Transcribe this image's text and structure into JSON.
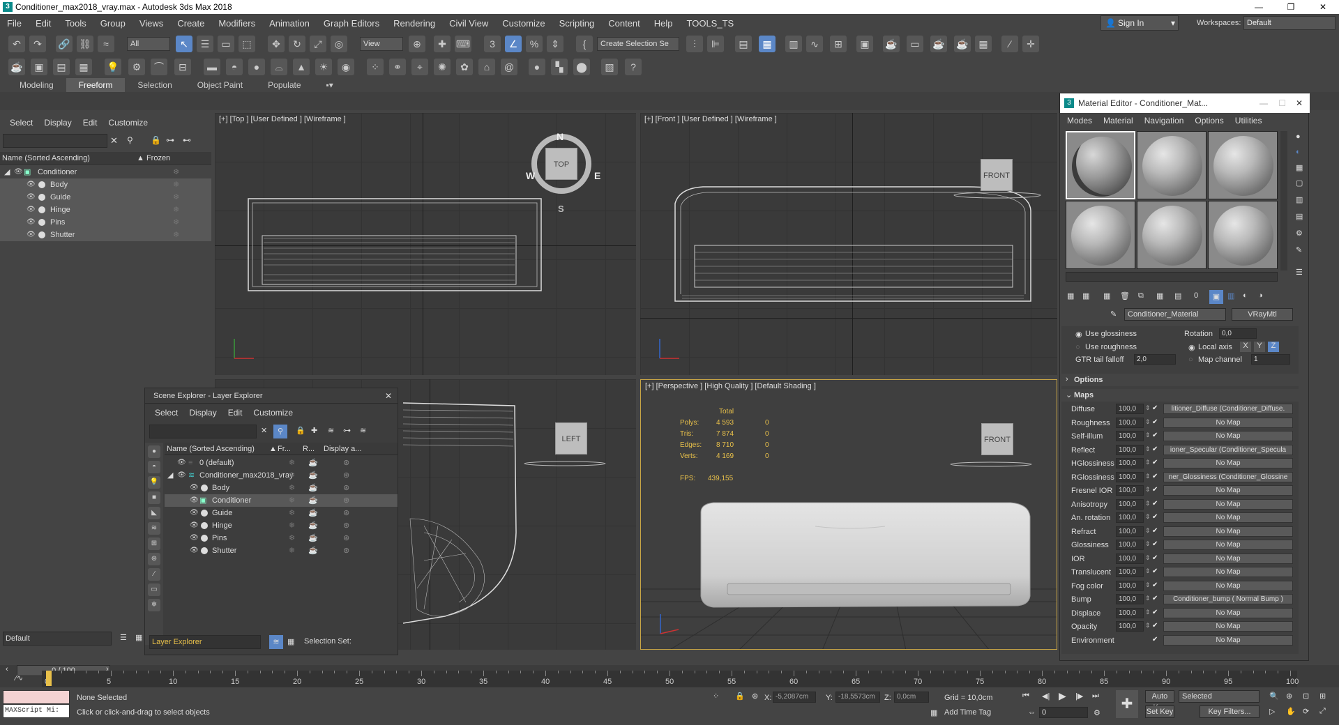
{
  "window": {
    "title": "Conditioner_max2018_vray.max - Autodesk 3ds Max 2018",
    "app_icon_letter": "3",
    "min": "—",
    "max": "❐",
    "close": "✕"
  },
  "menu": [
    "File",
    "Edit",
    "Tools",
    "Group",
    "Views",
    "Create",
    "Modifiers",
    "Animation",
    "Graph Editors",
    "Rendering",
    "Civil View",
    "Customize",
    "Scripting",
    "Content",
    "Help",
    "TOOLS_TS"
  ],
  "signin": "Sign In",
  "workspaces": {
    "label": "Workspaces:",
    "value": "Default"
  },
  "toolbar": {
    "filter_select": "All",
    "view_select": "View",
    "selection_set": "Create Selection Se"
  },
  "ribbon": [
    "Modeling",
    "Freeform",
    "Selection",
    "Object Paint",
    "Populate"
  ],
  "left_panel": {
    "menu": [
      "Select",
      "Display",
      "Edit",
      "Customize"
    ],
    "col_name": "Name (Sorted Ascending)",
    "col_frozen": "▲ Frozen",
    "root": "Conditioner",
    "children": [
      "Body",
      "Guide",
      "Hinge",
      "Pins",
      "Shutter"
    ],
    "layer_select": "Default"
  },
  "viewports": {
    "top": "[+] [Top ] [User Defined ] [Wireframe ]",
    "front": "[+] [Front ] [User Defined ] [Wireframe ]",
    "perspective": "[+] [Perspective ] [High Quality ] [Default Shading ]",
    "cube_top": "TOP",
    "cube_front": "FRONT",
    "cube_left": "LEFT",
    "compass": {
      "n": "N",
      "s": "S",
      "e": "E",
      "w": "W"
    }
  },
  "stats": {
    "header": "Total",
    "rows": [
      {
        "label": "Polys:",
        "total": "4 593",
        "sel": "0"
      },
      {
        "label": "Tris:",
        "total": "7 874",
        "sel": "0"
      },
      {
        "label": "Edges:",
        "total": "8 710",
        "sel": "0"
      },
      {
        "label": "Verts:",
        "total": "4 169",
        "sel": "0"
      }
    ],
    "fps_label": "FPS:",
    "fps": "439,155"
  },
  "layer_explorer": {
    "title": "Scene Explorer - Layer Explorer",
    "menu": [
      "Select",
      "Display",
      "Edit",
      "Customize"
    ],
    "cols": [
      "Name (Sorted Ascending)",
      "Fr...",
      "R...",
      "Display a..."
    ],
    "rows": [
      {
        "name": "0 (default)",
        "level": 1
      },
      {
        "name": "Conditioner_max2018_vray",
        "level": 1
      },
      {
        "name": "Body",
        "level": 2
      },
      {
        "name": "Conditioner",
        "level": 2
      },
      {
        "name": "Guide",
        "level": 2
      },
      {
        "name": "Hinge",
        "level": 2
      },
      {
        "name": "Pins",
        "level": 2
      },
      {
        "name": "Shutter",
        "level": 2
      }
    ],
    "footer_select": "Layer Explorer",
    "selection_set": "Selection Set:"
  },
  "material_editor": {
    "title": "Material Editor - Conditioner_Mat...",
    "menu": [
      "Modes",
      "Material",
      "Navigation",
      "Options",
      "Utilities"
    ],
    "material_name": "Conditioner_Material",
    "material_type": "VRayMtl",
    "use_glossiness": "Use glossiness",
    "use_roughness": "Use roughness",
    "rotation_label": "Rotation",
    "rotation_value": "0,0",
    "local_axis": "Local axis",
    "axes": [
      "X",
      "Y",
      "Z"
    ],
    "gtr_label": "GTR tail falloff",
    "gtr_value": "2,0",
    "map_channel_label": "Map channel",
    "map_channel_value": "1",
    "options_header": "Options",
    "maps_header": "Maps",
    "maps": [
      {
        "name": "Diffuse",
        "val": "100,0",
        "map": "litioner_Diffuse (Conditioner_Diffuse."
      },
      {
        "name": "Roughness",
        "val": "100,0",
        "map": "No Map"
      },
      {
        "name": "Self-illum",
        "val": "100,0",
        "map": "No Map"
      },
      {
        "name": "Reflect",
        "val": "100,0",
        "map": "ioner_Specular (Conditioner_Specula"
      },
      {
        "name": "HGlossiness",
        "val": "100,0",
        "map": "No Map"
      },
      {
        "name": "RGlossiness",
        "val": "100,0",
        "map": "ner_Glossiness (Conditioner_Glossine"
      },
      {
        "name": "Fresnel IOR",
        "val": "100,0",
        "map": "No Map"
      },
      {
        "name": "Anisotropy",
        "val": "100,0",
        "map": "No Map"
      },
      {
        "name": "An. rotation",
        "val": "100,0",
        "map": "No Map"
      },
      {
        "name": "Refract",
        "val": "100,0",
        "map": "No Map"
      },
      {
        "name": "Glossiness",
        "val": "100,0",
        "map": "No Map"
      },
      {
        "name": "IOR",
        "val": "100,0",
        "map": "No Map"
      },
      {
        "name": "Translucent",
        "val": "100,0",
        "map": "No Map"
      },
      {
        "name": "Fog color",
        "val": "100,0",
        "map": "No Map"
      },
      {
        "name": "Bump",
        "val": "100,0",
        "map": "Conditioner_bump ( Normal Bump )"
      },
      {
        "name": "Displace",
        "val": "100,0",
        "map": "No Map"
      },
      {
        "name": "Opacity",
        "val": "100,0",
        "map": "No Map"
      },
      {
        "name": "Environment",
        "val": "",
        "map": "No Map"
      }
    ]
  },
  "timeline": {
    "frame": "0 / 100",
    "ticks": [
      "0",
      "5",
      "10",
      "15",
      "20",
      "25",
      "30",
      "35",
      "40",
      "45",
      "50",
      "55",
      "60",
      "65",
      "70",
      "75",
      "80",
      "85",
      "90",
      "95",
      "100"
    ]
  },
  "status": {
    "maxscript": "MAXScript Mi:",
    "none_selected": "None Selected",
    "hint": "Click or click-and-drag to select objects",
    "x_label": "X:",
    "x": "-5,2087cm",
    "y_label": "Y:",
    "y": "-18,5573cm",
    "z_label": "Z:",
    "z": "0,0cm",
    "grid": "Grid = 10,0cm",
    "add_time_tag": "Add Time Tag",
    "auto_key": "Auto Key",
    "selected": "Selected",
    "set_key": "Set Key",
    "key_filters": "Key Filters...",
    "frame_field": "0"
  }
}
